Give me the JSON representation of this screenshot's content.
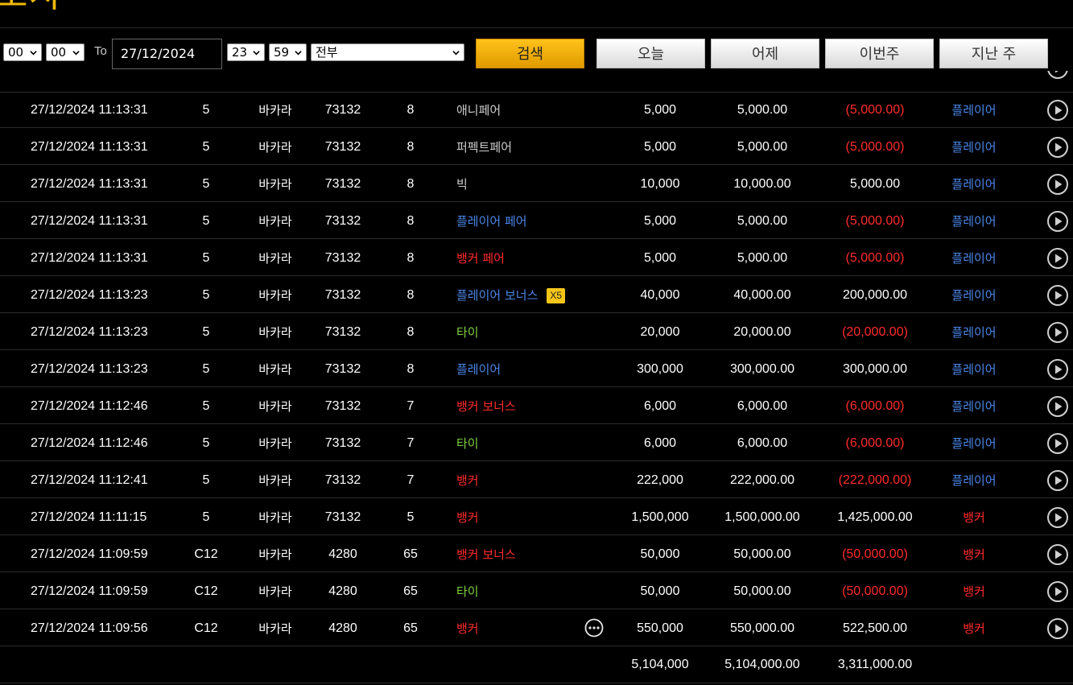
{
  "header": {
    "title": "조사"
  },
  "filter": {
    "from_hour": "00",
    "from_minute": "00",
    "to_label": "To",
    "to_date": "27/12/2024",
    "to_hour": "23",
    "to_minute": "59",
    "category": "전부",
    "search_label": "검색",
    "today_label": "오늘",
    "yesterday_label": "어제",
    "this_week_label": "이번주",
    "last_week_label": "지난 주"
  },
  "colors": {
    "accent": "#f0b90b",
    "player": "#4a86e8",
    "banker": "#ff2b2b",
    "tie": "#7fd13b",
    "neutral_bet": "#cccccc",
    "negative": "#ff2b2b",
    "positive": "#ffffff"
  },
  "rows": [
    {
      "time": "27/12/2024 11:13:31",
      "type": "5",
      "game": "바카라",
      "table": "73132",
      "round": "8",
      "bet": "애니페어",
      "bet_color": "neutral",
      "badge": "",
      "amount": "5,000",
      "valid": "5,000.00",
      "winloss": "(5,000.00)",
      "negative": true,
      "result": "플레이어",
      "result_color": "player",
      "icon": "play-circle-icon"
    },
    {
      "time": "27/12/2024 11:13:31",
      "type": "5",
      "game": "바카라",
      "table": "73132",
      "round": "8",
      "bet": "퍼펙트페어",
      "bet_color": "neutral",
      "badge": "",
      "amount": "5,000",
      "valid": "5,000.00",
      "winloss": "(5,000.00)",
      "negative": true,
      "result": "플레이어",
      "result_color": "player",
      "icon": "play-circle-icon"
    },
    {
      "time": "27/12/2024 11:13:31",
      "type": "5",
      "game": "바카라",
      "table": "73132",
      "round": "8",
      "bet": "빅",
      "bet_color": "neutral",
      "badge": "",
      "amount": "10,000",
      "valid": "10,000.00",
      "winloss": "5,000.00",
      "negative": false,
      "result": "플레이어",
      "result_color": "player",
      "icon": "play-circle-icon"
    },
    {
      "time": "27/12/2024 11:13:31",
      "type": "5",
      "game": "바카라",
      "table": "73132",
      "round": "8",
      "bet": "플레이어 페어",
      "bet_color": "player",
      "badge": "",
      "amount": "5,000",
      "valid": "5,000.00",
      "winloss": "(5,000.00)",
      "negative": true,
      "result": "플레이어",
      "result_color": "player",
      "icon": "play-circle-icon"
    },
    {
      "time": "27/12/2024 11:13:31",
      "type": "5",
      "game": "바카라",
      "table": "73132",
      "round": "8",
      "bet": "뱅커 페어",
      "bet_color": "banker",
      "badge": "",
      "amount": "5,000",
      "valid": "5,000.00",
      "winloss": "(5,000.00)",
      "negative": true,
      "result": "플레이어",
      "result_color": "player",
      "icon": "play-circle-icon"
    },
    {
      "time": "27/12/2024 11:13:23",
      "type": "5",
      "game": "바카라",
      "table": "73132",
      "round": "8",
      "bet": "플레이어 보너스",
      "bet_color": "player",
      "badge": "X5",
      "amount": "40,000",
      "valid": "40,000.00",
      "winloss": "200,000.00",
      "negative": false,
      "result": "플레이어",
      "result_color": "player",
      "icon": "play-circle-icon"
    },
    {
      "time": "27/12/2024 11:13:23",
      "type": "5",
      "game": "바카라",
      "table": "73132",
      "round": "8",
      "bet": "타이",
      "bet_color": "tie",
      "badge": "",
      "amount": "20,000",
      "valid": "20,000.00",
      "winloss": "(20,000.00)",
      "negative": true,
      "result": "플레이어",
      "result_color": "player",
      "icon": "play-circle-icon"
    },
    {
      "time": "27/12/2024 11:13:23",
      "type": "5",
      "game": "바카라",
      "table": "73132",
      "round": "8",
      "bet": "플레이어",
      "bet_color": "player",
      "badge": "",
      "amount": "300,000",
      "valid": "300,000.00",
      "winloss": "300,000.00",
      "negative": false,
      "result": "플레이어",
      "result_color": "player",
      "icon": "play-circle-icon"
    },
    {
      "time": "27/12/2024 11:12:46",
      "type": "5",
      "game": "바카라",
      "table": "73132",
      "round": "7",
      "bet": "뱅커 보너스",
      "bet_color": "banker",
      "badge": "",
      "amount": "6,000",
      "valid": "6,000.00",
      "winloss": "(6,000.00)",
      "negative": true,
      "result": "플레이어",
      "result_color": "player",
      "icon": "play-circle-icon"
    },
    {
      "time": "27/12/2024 11:12:46",
      "type": "5",
      "game": "바카라",
      "table": "73132",
      "round": "7",
      "bet": "타이",
      "bet_color": "tie",
      "badge": "",
      "amount": "6,000",
      "valid": "6,000.00",
      "winloss": "(6,000.00)",
      "negative": true,
      "result": "플레이어",
      "result_color": "player",
      "icon": "play-circle-icon"
    },
    {
      "time": "27/12/2024 11:12:41",
      "type": "5",
      "game": "바카라",
      "table": "73132",
      "round": "7",
      "bet": "뱅커",
      "bet_color": "banker",
      "badge": "",
      "amount": "222,000",
      "valid": "222,000.00",
      "winloss": "(222,000.00)",
      "negative": true,
      "result": "플레이어",
      "result_color": "player",
      "icon": "play-circle-icon"
    },
    {
      "time": "27/12/2024 11:11:15",
      "type": "5",
      "game": "바카라",
      "table": "73132",
      "round": "5",
      "bet": "뱅커",
      "bet_color": "banker",
      "badge": "",
      "amount": "1,500,000",
      "valid": "1,500,000.00",
      "winloss": "1,425,000.00",
      "negative": false,
      "result": "뱅커",
      "result_color": "banker",
      "icon": "play-circle-icon"
    },
    {
      "time": "27/12/2024 11:09:59",
      "type": "C12",
      "game": "바카라",
      "table": "4280",
      "round": "65",
      "bet": "뱅커 보너스",
      "bet_color": "banker",
      "badge": "",
      "amount": "50,000",
      "valid": "50,000.00",
      "winloss": "(50,000.00)",
      "negative": true,
      "result": "뱅커",
      "result_color": "banker",
      "icon": "play-circle-icon"
    },
    {
      "time": "27/12/2024 11:09:59",
      "type": "C12",
      "game": "바카라",
      "table": "4280",
      "round": "65",
      "bet": "타이",
      "bet_color": "tie",
      "badge": "",
      "amount": "50,000",
      "valid": "50,000.00",
      "winloss": "(50,000.00)",
      "negative": true,
      "result": "뱅커",
      "result_color": "banker",
      "icon": "play-circle-icon"
    },
    {
      "time": "27/12/2024 11:09:56",
      "type": "C12",
      "game": "바카라",
      "table": "4280",
      "round": "65",
      "bet": "뱅커",
      "bet_color": "banker",
      "badge": "",
      "amount": "550,000",
      "valid": "550,000.00",
      "winloss": "522,500.00",
      "negative": false,
      "result": "뱅커",
      "result_color": "banker",
      "icon": "play-circle-icon",
      "more": "more-options-icon"
    }
  ],
  "totals": {
    "amount": "5,104,000",
    "valid": "5,104,000.00",
    "winloss": "3,311,000.00"
  }
}
